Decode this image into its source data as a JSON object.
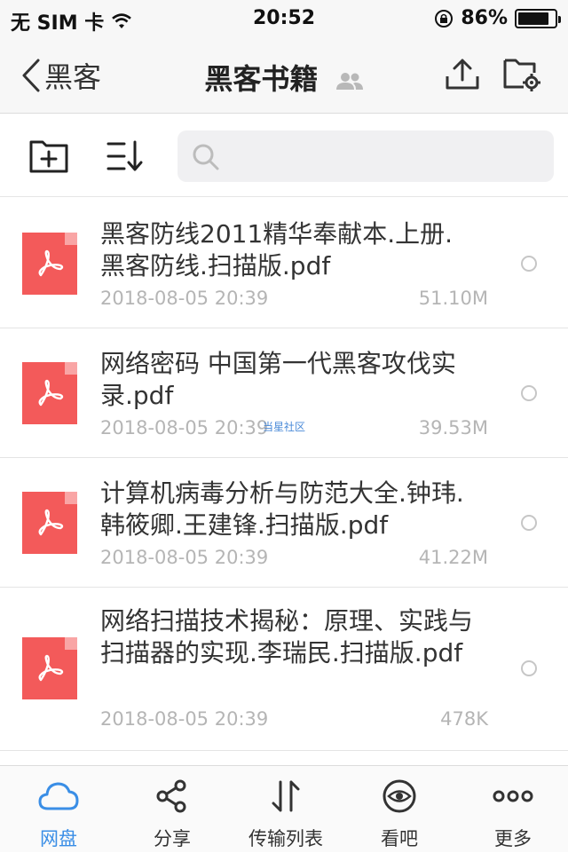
{
  "status_bar": {
    "carrier": "无 SIM 卡",
    "time": "20:52",
    "battery": "86%",
    "battery_level": 0.86
  },
  "nav": {
    "back_label": "黑客",
    "title": "黑客书籍"
  },
  "toolbar": {
    "search_placeholder": ""
  },
  "files": [
    {
      "name": "黑客防线2011精华奉献本.上册.黑客防线.扫描版.pdf",
      "date": "2018-08-05 20:39",
      "size": "51.10M"
    },
    {
      "name": "网络密码 中国第一代黑客攻伐实录.pdf",
      "date": "2018-08-05 20:39",
      "size": "39.53M",
      "watermark": "当星社区"
    },
    {
      "name": "计算机病毒分析与防范大全.钟玮.韩筱卿.王建锋.扫描版.pdf",
      "date": "2018-08-05 20:39",
      "size": "41.22M"
    },
    {
      "name": "网络扫描技术揭秘：原理、实践与扫描器的实现.李瑞民.扫描版.pdf",
      "date": "2018-08-05 20:39",
      "size": "478K"
    }
  ],
  "tabs": [
    {
      "label": "网盘",
      "icon": "cloud-icon",
      "active": true
    },
    {
      "label": "分享",
      "icon": "share-icon",
      "active": false
    },
    {
      "label": "传输列表",
      "icon": "transfer-icon",
      "active": false
    },
    {
      "label": "看吧",
      "icon": "eye-icon",
      "active": false
    },
    {
      "label": "更多",
      "icon": "more-icon",
      "active": false
    }
  ],
  "colors": {
    "accent": "#3a8ee6",
    "pdf_red": "#f35a5a"
  }
}
